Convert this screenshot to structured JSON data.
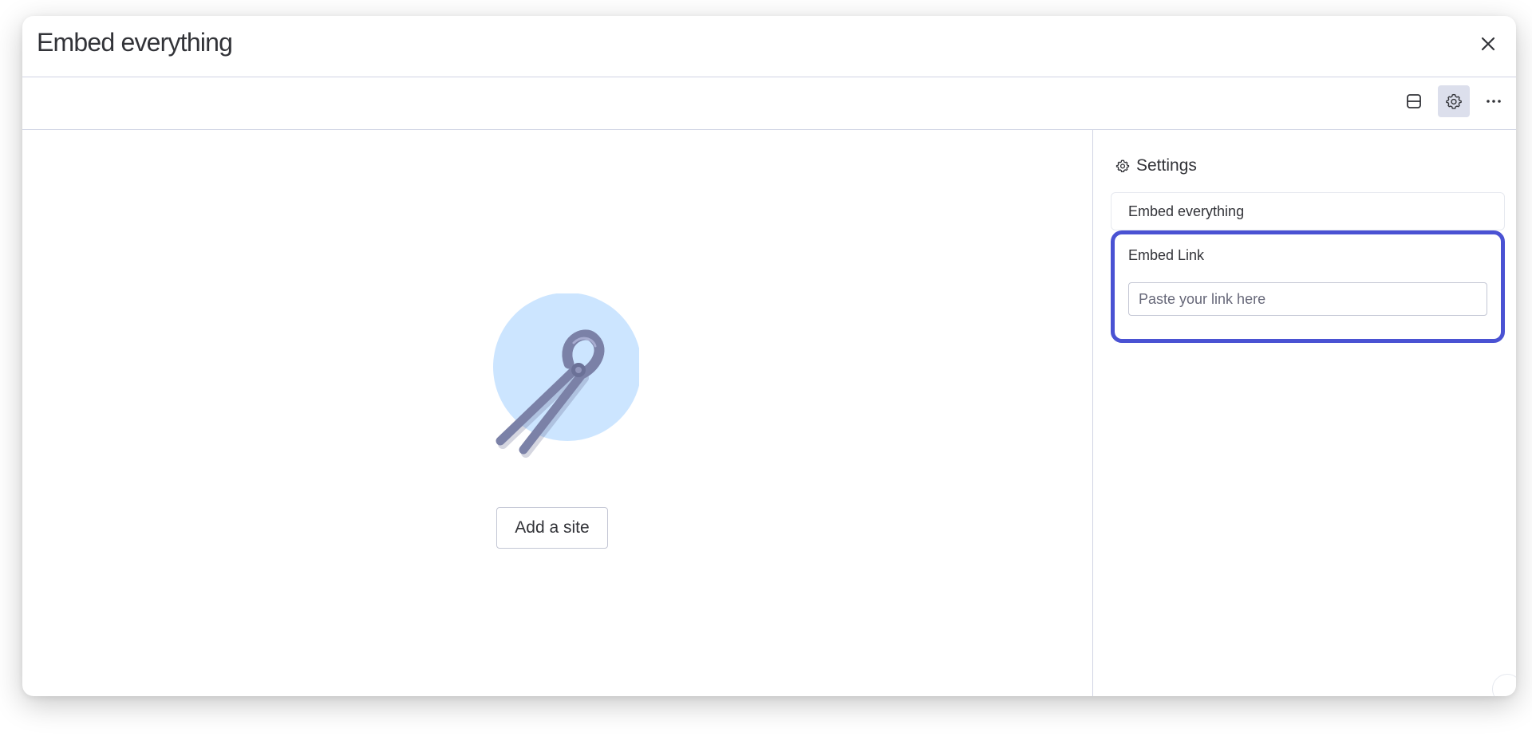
{
  "modal": {
    "title": "Embed everything"
  },
  "toolbar": {
    "layout_icon": "layout-icon",
    "settings_icon": "gear-icon",
    "more_icon": "more-horizontal-icon",
    "settings_active": true
  },
  "main": {
    "illustration_icon": "pliers-icon",
    "add_site_label": "Add a site"
  },
  "settings": {
    "title": "Settings",
    "widget_name": "Embed everything",
    "embed_link_label": "Embed Link",
    "embed_link_placeholder": "Paste your link here",
    "embed_link_value": ""
  },
  "colors": {
    "accent_border": "#4a52d3",
    "illustration_bg": "#cce5ff",
    "active_tool_bg": "#dcdfec"
  }
}
